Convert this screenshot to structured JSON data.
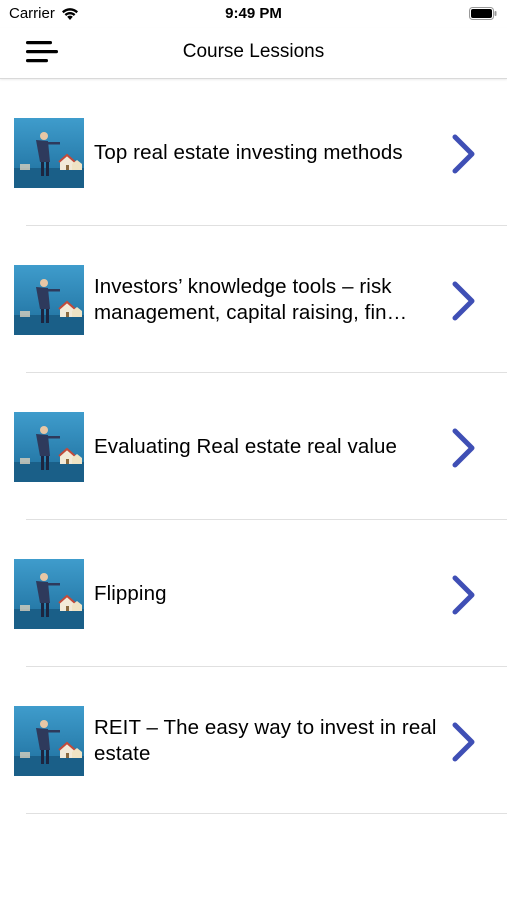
{
  "status_bar": {
    "carrier": "Carrier",
    "time": "9:49 PM",
    "icons": [
      "wifi-icon",
      "battery-icon"
    ]
  },
  "nav": {
    "title": "Course Lessions",
    "menu_icon": "hamburger-menu-icon"
  },
  "colors": {
    "chevron": "#3f4fb5",
    "separator": "#e0e0e0",
    "thumb_sky": "#2a87b8"
  },
  "lessons": [
    {
      "title": "Top real estate investing methods",
      "thumbnail": "investor-houses-thumbnail"
    },
    {
      "title": "Investors’ knowledge tools – risk management, capital raising, fin…",
      "thumbnail": "investor-houses-thumbnail"
    },
    {
      "title": "Evaluating Real estate real value",
      "thumbnail": "investor-houses-thumbnail"
    },
    {
      "title": "Flipping",
      "thumbnail": "investor-houses-thumbnail"
    },
    {
      "title": "REIT – The easy way to invest in real estate",
      "thumbnail": "investor-houses-thumbnail"
    }
  ]
}
